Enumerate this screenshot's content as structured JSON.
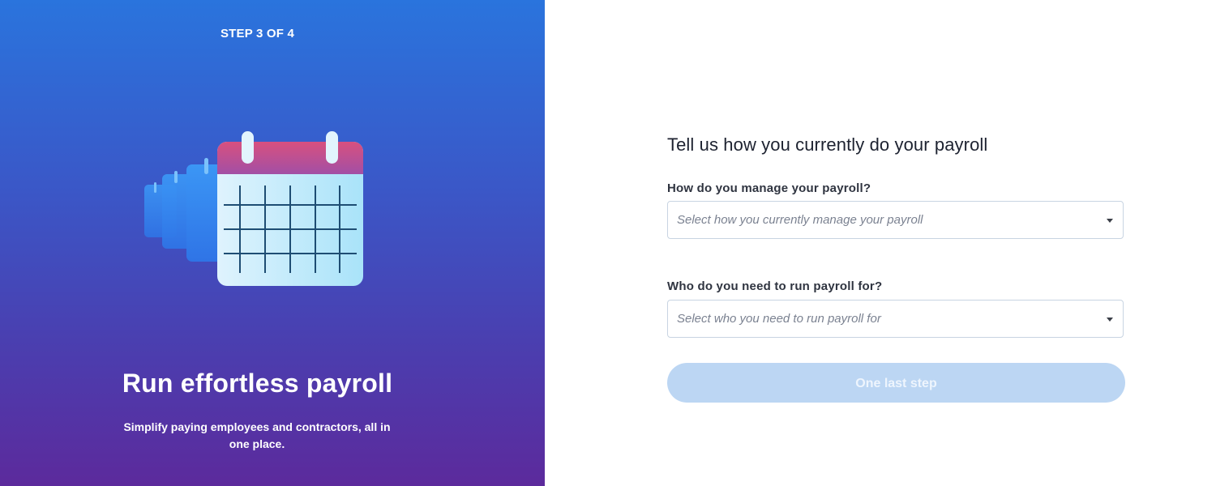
{
  "left_panel": {
    "step_indicator": "STEP 3 OF 4",
    "illustration_icon": "calendar-icon",
    "title": "Run effortless payroll",
    "subtitle": "Simplify paying employees and contractors, all in one place.",
    "gradient_top_color": "#2a74dd",
    "gradient_bottom_color": "#5c2a9c"
  },
  "form": {
    "heading": "Tell us how you currently do your payroll",
    "manage_field": {
      "label": "How do you manage your payroll?",
      "placeholder": "Select how you currently manage your payroll"
    },
    "payroll_for_field": {
      "label": "Who do you need to run payroll for?",
      "placeholder": "Select who you need to run payroll for"
    },
    "submit_label": "One last step",
    "submit_color": "#bcd6f3"
  }
}
